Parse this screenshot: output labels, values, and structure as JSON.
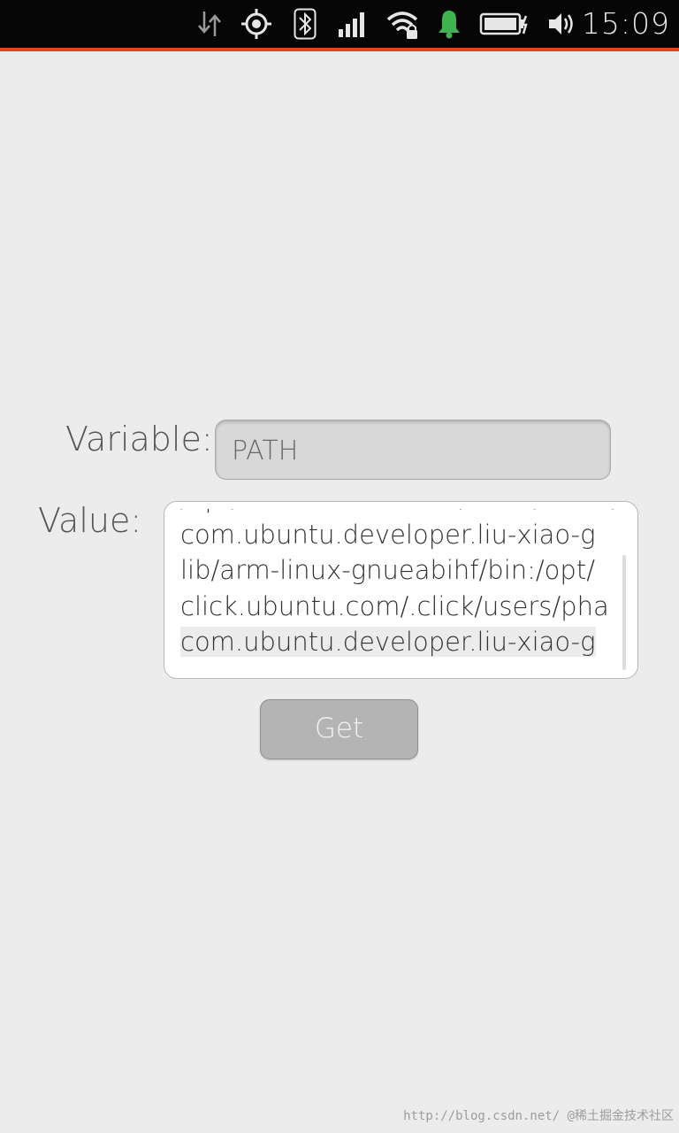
{
  "status_bar": {
    "time": "15:09",
    "icons": [
      "network-transfer-icon",
      "location-icon",
      "bluetooth-icon",
      "cellular-signal-icon",
      "wifi-icon",
      "notification-bell-icon",
      "battery-charging-icon",
      "volume-icon"
    ],
    "accent_color": "#dd4814",
    "notification_color": "#3eb34f"
  },
  "form": {
    "variable_label": "Variable:",
    "variable_value": "PATH",
    "value_label": "Value:",
    "value_lines": [
      "/opt/click.ubuntu.com/.click/users/",
      "com.ubuntu.developer.liu-xiao-g",
      "lib/arm-linux-gnueabihf/bin:/opt/",
      "click.ubuntu.com/.click/users/pha",
      "com.ubuntu.developer.liu-xiao-g"
    ],
    "get_button": "Get"
  },
  "watermark": "http://blog.csdn.net/ @稀土掘金技术社区"
}
